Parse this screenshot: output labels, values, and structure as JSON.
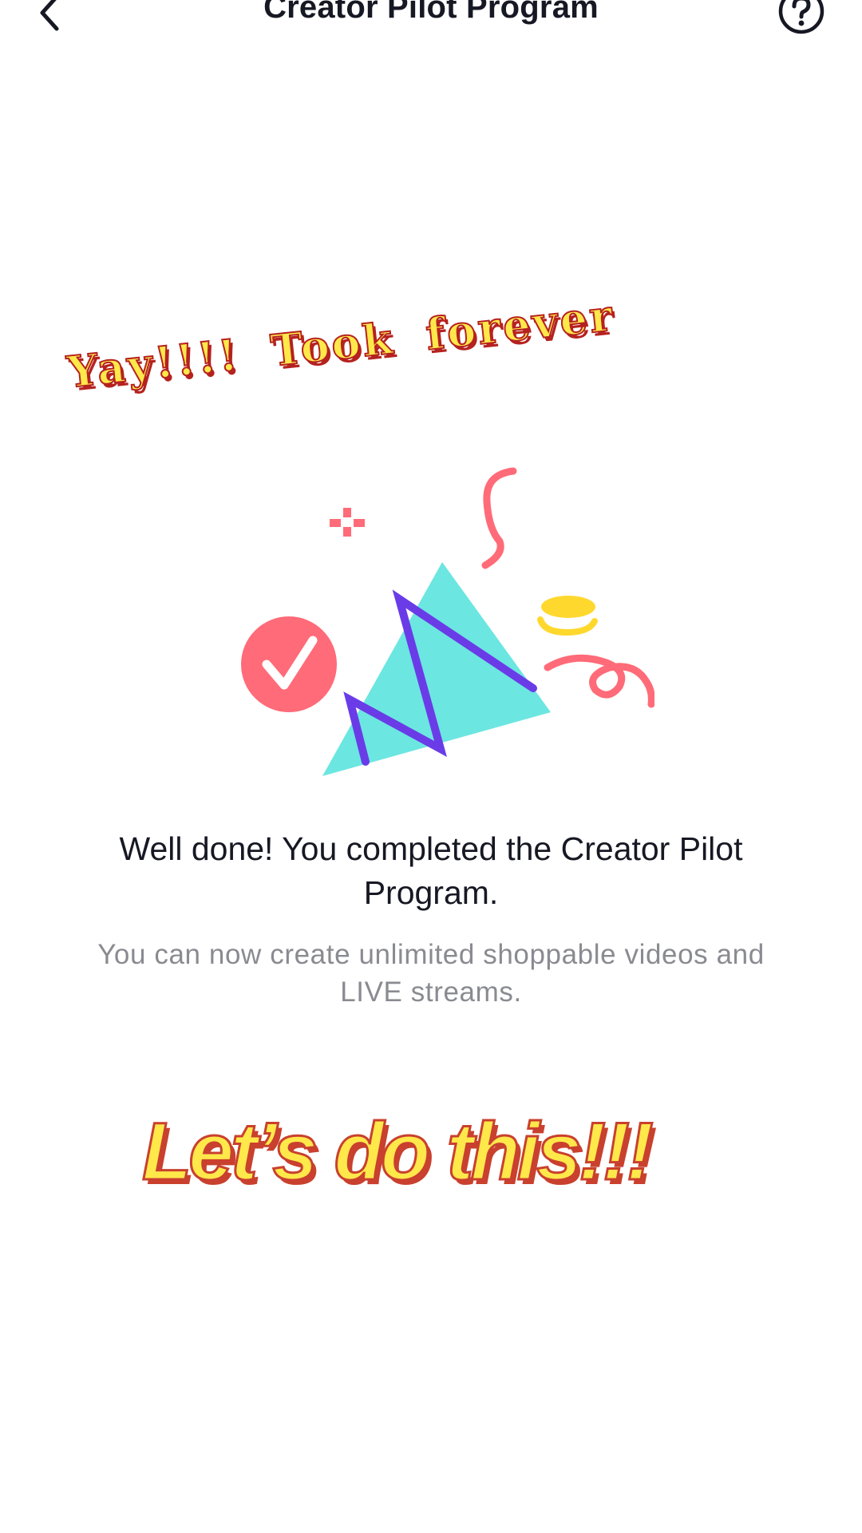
{
  "header": {
    "title": "Creator Pilot Program"
  },
  "stickers": {
    "top_text": "Yay!!!! Took forever",
    "bottom_text": "Let’s do this!!!"
  },
  "message": {
    "title": "Well done! You completed the Creator Pilot Program.",
    "subtitle": "You can now create unlimited shoppable videos and LIVE streams."
  },
  "icons": {
    "back": "chevron-left-icon",
    "help": "question-circle-icon",
    "illustration": "celebration-party-hat-illustration"
  },
  "colors": {
    "triangle": "#6CE6E0",
    "zigzag": "#6A3CE8",
    "checkmark_circle": "#FF6B78",
    "squiggle": "#FF6B78",
    "coin": "#FFD82E",
    "sticker_fill": "#FFE84A",
    "sticker_outline": "#B5221F"
  }
}
